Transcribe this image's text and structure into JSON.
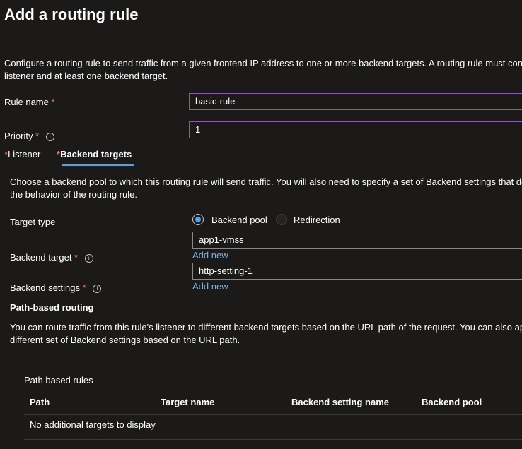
{
  "page": {
    "title": "Add a routing rule",
    "description": "Configure a routing rule to send traffic from a given frontend IP address to one or more backend targets. A routing rule must contain a listener and at least one backend target."
  },
  "rule_name": {
    "label": "Rule name",
    "required": "*",
    "value": "basic-rule"
  },
  "priority": {
    "label": "Priority",
    "required": "*",
    "info": "i",
    "value": "1"
  },
  "tabs": [
    {
      "required": "*",
      "label": "Listener"
    },
    {
      "required": "*",
      "label": "Backend targets"
    }
  ],
  "backend": {
    "description": "Choose a backend pool to which this routing rule will send traffic. You will also need to specify a set of Backend settings that define the behavior of the routing rule.",
    "target_type": {
      "label": "Target type",
      "options": [
        "Backend pool",
        "Redirection"
      ],
      "selected": "Backend pool"
    },
    "backend_target": {
      "label": "Backend target",
      "required": "*",
      "info": "i",
      "value": "app1-vmss",
      "add_new": "Add new"
    },
    "backend_settings": {
      "label": "Backend settings",
      "required": "*",
      "info": "i",
      "value": "http-setting-1",
      "add_new": "Add new"
    }
  },
  "path_routing": {
    "heading": "Path-based routing",
    "description": "You can route traffic from this rule's listener to different backend targets based on the URL path of the request. You can also apply a different set of Backend settings based on the URL path.",
    "table_title": "Path based rules",
    "columns": [
      "Path",
      "Target name",
      "Backend setting name",
      "Backend pool"
    ],
    "empty_message": "No additional targets to display"
  },
  "colors": {
    "background": "#1b1a19",
    "input_border_focus": "#8a5ca8",
    "accent": "#4ba3ec",
    "link": "#75b6e7",
    "required": "#f1707b"
  }
}
